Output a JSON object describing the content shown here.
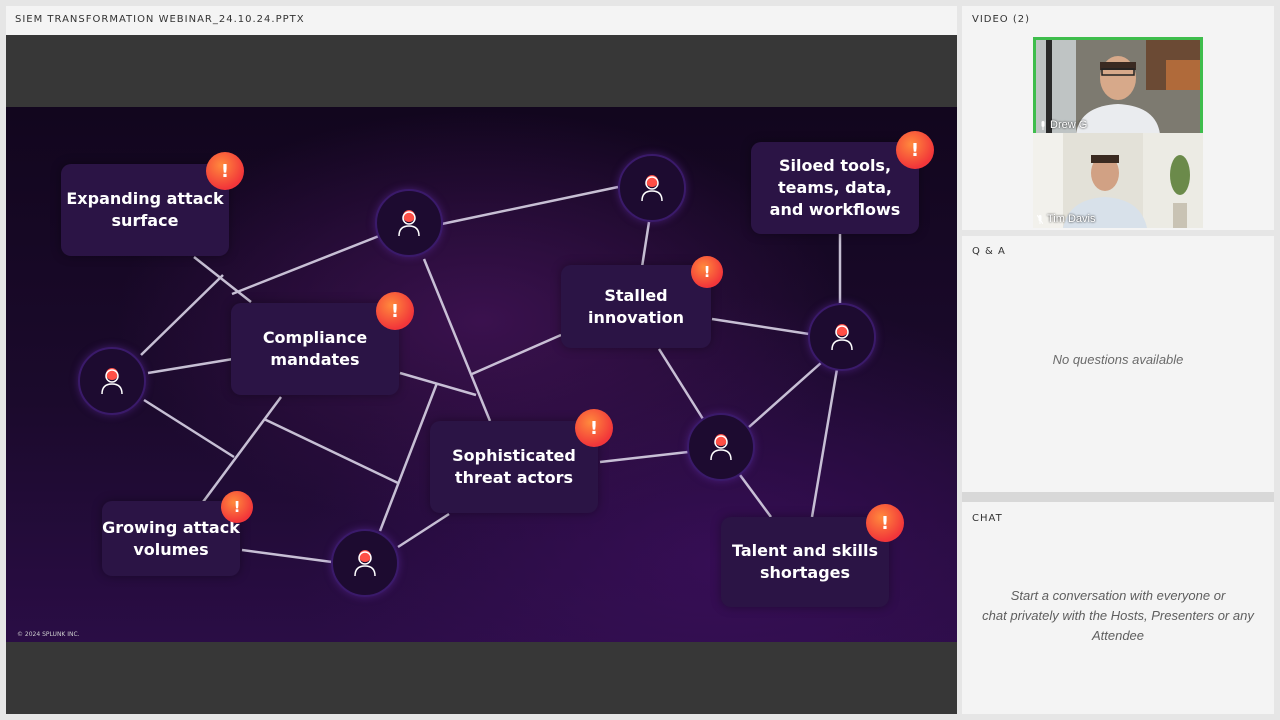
{
  "presentation": {
    "title": "SIEM TRANSFORMATION WEBINAR_24.10.24.PPTX",
    "slide": {
      "cards": [
        {
          "id": "expanding",
          "text": "Expanding attack\nsurface"
        },
        {
          "id": "compliance",
          "text": "Compliance\nmandates"
        },
        {
          "id": "growing",
          "text": "Growing attack\nvolumes"
        },
        {
          "id": "sophisticated",
          "text": "Sophisticated\nthreat actors"
        },
        {
          "id": "stalled",
          "text": "Stalled\ninnovation"
        },
        {
          "id": "siloed",
          "text": "Siloed tools,\nteams, data,\nand workflows"
        },
        {
          "id": "talent",
          "text": "Talent and skills\nshortages"
        }
      ],
      "badge_symbol": "!",
      "node_icon": "person-icon",
      "copyright": "© 2024 SPLUNK INC.",
      "colors": {
        "badge": "#f2363a",
        "card": "#2b1445",
        "line": "#d9d3e6"
      }
    }
  },
  "video": {
    "title": "VIDEO (2)",
    "participants": [
      {
        "name": "Drew G",
        "active": true
      },
      {
        "name": "Tim Davis",
        "active": false
      }
    ],
    "active_color": "#3ebd4c"
  },
  "qa": {
    "title": "Q & A",
    "empty_text": "No questions available"
  },
  "chat": {
    "title": "CHAT",
    "empty_lines": [
      "Start a conversation with everyone or",
      "chat privately with the Hosts, Presenters or any",
      "Attendee"
    ]
  }
}
